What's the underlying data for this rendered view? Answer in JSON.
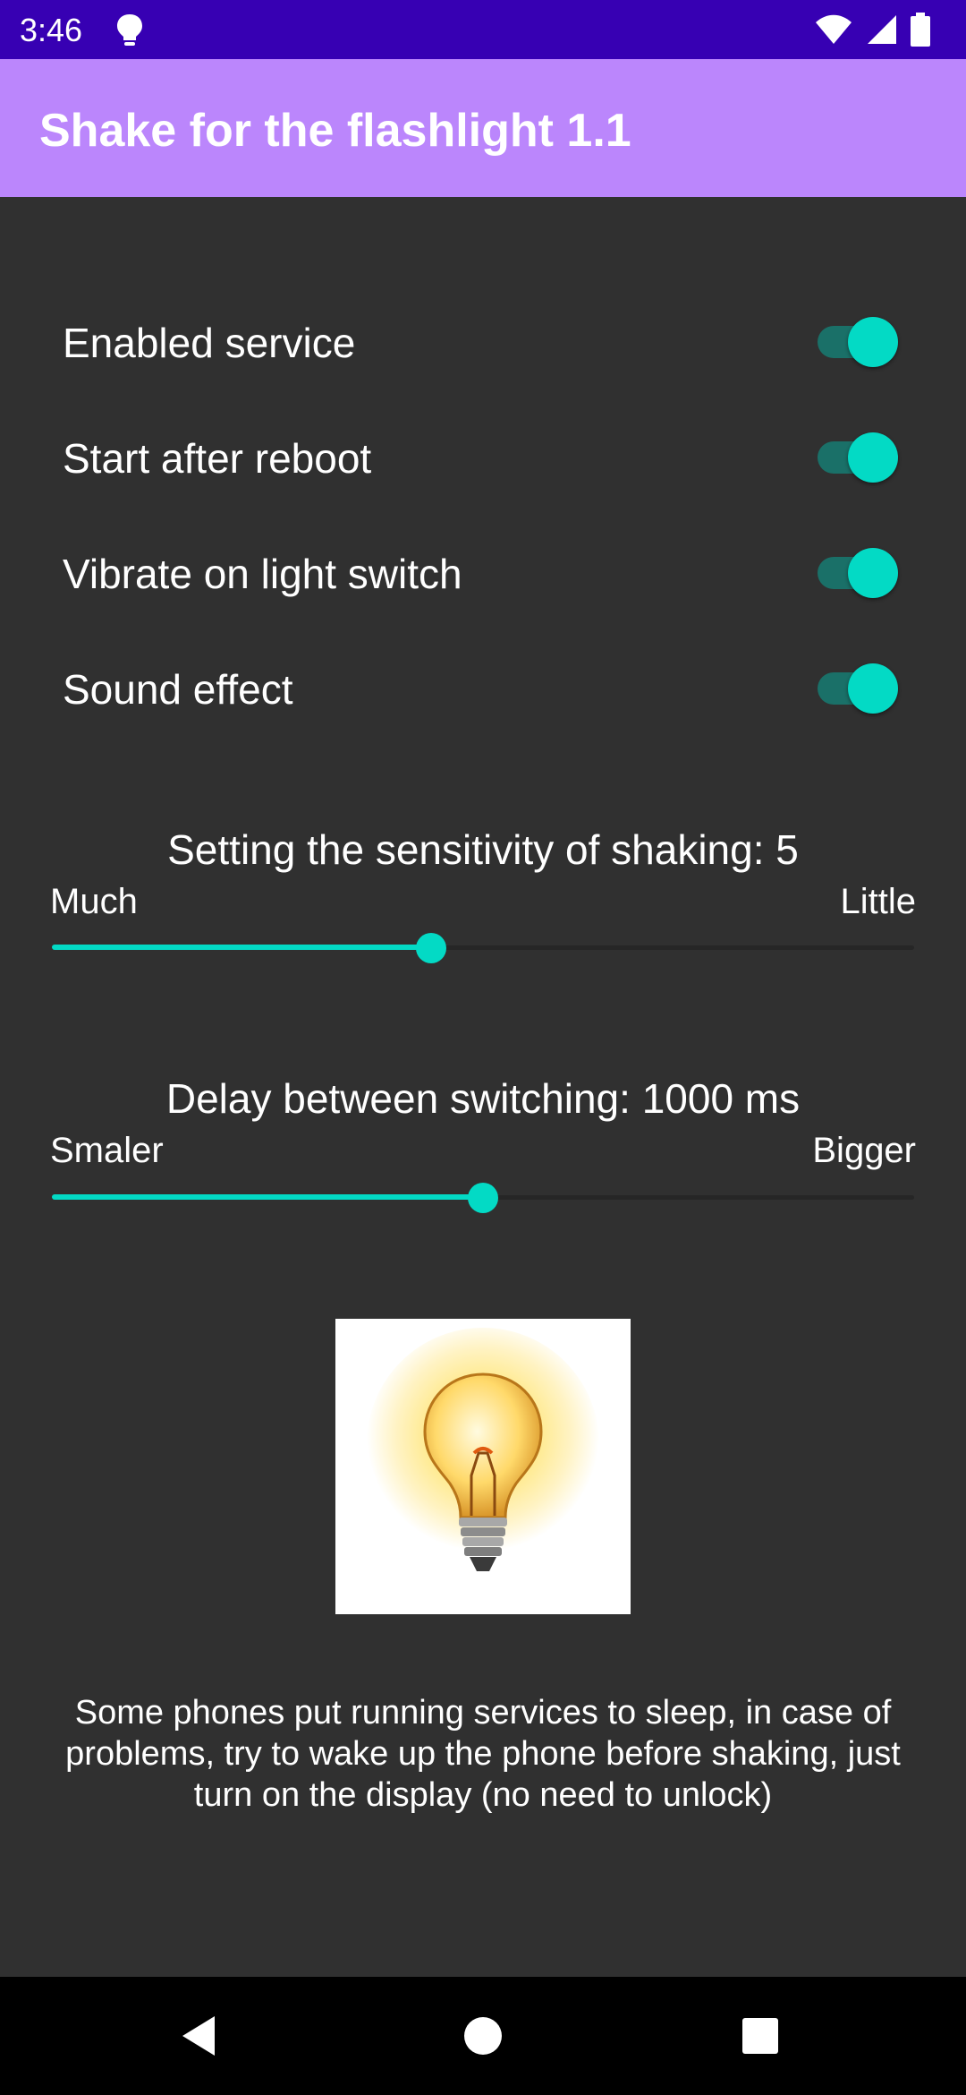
{
  "status_bar": {
    "time": "3:46",
    "icons": [
      "lightbulb-icon",
      "wifi-icon",
      "signal-icon",
      "battery-icon"
    ],
    "background": "#3700b3"
  },
  "app_bar": {
    "title": "Shake for the flashlight 1.1",
    "background": "#bb86fc"
  },
  "settings": [
    {
      "label": "Enabled service",
      "enabled": true
    },
    {
      "label": "Start after reboot",
      "enabled": true
    },
    {
      "label": "Vibrate on light switch",
      "enabled": true
    },
    {
      "label": "Sound effect",
      "enabled": true
    }
  ],
  "sensitivity": {
    "title": "Setting the sensitivity of shaking: 5",
    "min_label": "Much",
    "max_label": "Little",
    "fraction": 0.44
  },
  "delay": {
    "title": "Delay between switching: 1000 ms",
    "min_label": "Smaler",
    "max_label": "Bigger",
    "fraction": 0.5
  },
  "image": {
    "icon": "lightbulb-image"
  },
  "note": "Some phones put running services to sleep, in case of problems, try to wake up the phone before shaking, just turn on the display (no need to unlock)",
  "nav": [
    "back-icon",
    "home-icon",
    "recents-icon"
  ],
  "colors": {
    "accent": "#03dac5",
    "background": "#303030"
  }
}
